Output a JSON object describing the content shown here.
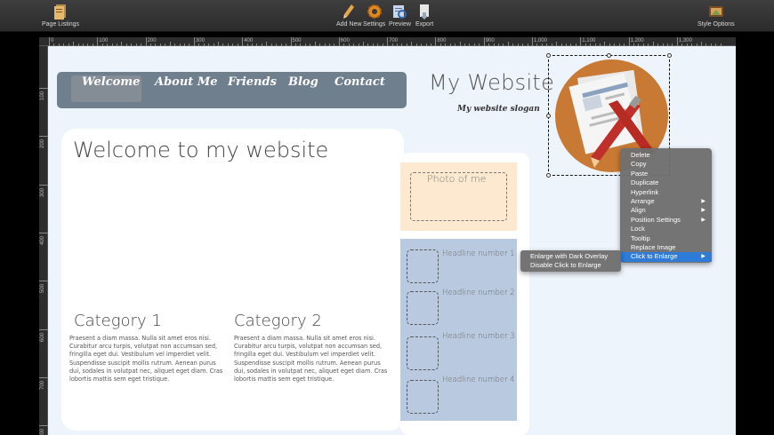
{
  "toolbar": {
    "page_listings": "Page Listings",
    "add_new": "Add New",
    "settings": "Settings",
    "preview": "Preview",
    "export": "Export",
    "style_options": "Style Options"
  },
  "ruler": {
    "top": [
      "0",
      "100",
      "200",
      "300",
      "400",
      "500",
      "600",
      "700",
      "800",
      "900",
      "1,000",
      "1,100",
      "1,200",
      "1,300"
    ],
    "left": [
      "100",
      "200",
      "300",
      "400",
      "500",
      "600",
      "700",
      "800"
    ]
  },
  "site": {
    "nav": [
      "Welcome",
      "About Me",
      "Friends",
      "Blog",
      "Contact"
    ],
    "title": "My Website",
    "slogan": "My website slogan",
    "welcome": "Welcome to my website",
    "categories": [
      {
        "title": "Category 1",
        "text": "Praesent a diam massa. Nulla sit amet eros nisi. Curabitur arcu turpis, volutpat non accumsan sed, fringilla eget dui. Vestibulum vel imperdiet velit. Suspendisse suscipit mollis rutrum. Aenean purus dui, sodales in volutpat nec, aliquet eget diam. Cras lobortis mattis sem eget tristique."
      },
      {
        "title": "Category 2",
        "text": "Praesent a diam massa. Nulla sit amet eros nisi. Curabitur arcu turpis, volutpat non accumsan sed, fringilla eget dui. Vestibulum vel imperdiet velit. Suspendisse suscipit mollis rutrum. Aenean purus dui, sodales in volutpat nec, aliquet eget diam. Cras lobortis mattis sem eget tristique."
      }
    ],
    "photo_label": "Photo of me",
    "headlines": [
      "Headline number 1",
      "Headline number 2",
      "Headline number 3",
      "Headline number 4"
    ]
  },
  "context_menu": {
    "items": [
      "Delete",
      "Copy",
      "Paste",
      "Duplicate",
      "Hyperlink",
      "Arrange",
      "Align",
      "Position Settings",
      "Lock",
      "Tooltip",
      "Replace Image",
      "Click to Enlarge"
    ],
    "has_submenu": [
      false,
      false,
      false,
      false,
      false,
      true,
      true,
      true,
      false,
      false,
      false,
      true
    ],
    "active_index": 11,
    "submenu": [
      "Enlarge with Dark Overlay",
      "Disable Click to Enlarge"
    ]
  },
  "colors": {
    "toolbar_bg": "#333333",
    "navbar": "#6f7f8e",
    "photo_bg": "#fce9cf",
    "headlines_bg": "#b8c9e0",
    "menu_highlight": "#2e7bd8",
    "logo_orange": "#c87a34"
  }
}
